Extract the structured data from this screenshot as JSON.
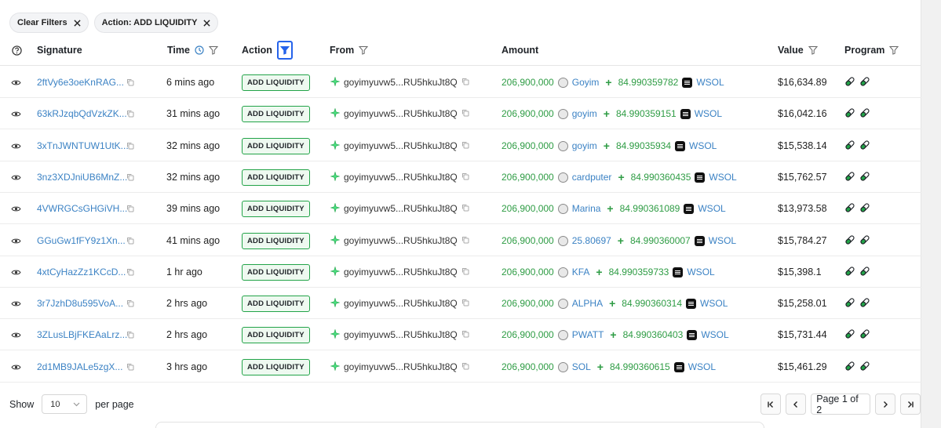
{
  "filters": [
    {
      "label": "Clear Filters"
    },
    {
      "label": "Action: ADD LIQUIDITY"
    }
  ],
  "columns": {
    "signature": "Signature",
    "time": "Time",
    "action": "Action",
    "from": "From",
    "amount": "Amount",
    "value": "Value",
    "program": "Program"
  },
  "rows": [
    {
      "signature": "2ftVy6e3oeKnRAG...",
      "time": "6 mins ago",
      "action": "ADD LIQUIDITY",
      "from": "goyimyuvw5...RU5hkuJt8Q",
      "amount": "206,900,000",
      "token": "Goyim",
      "sol_amount": "84.990359782",
      "sol_token": "WSOL",
      "value": "$16,634.89"
    },
    {
      "signature": "63kRJzqbQdVzkZK...",
      "time": "31 mins ago",
      "action": "ADD LIQUIDITY",
      "from": "goyimyuvw5...RU5hkuJt8Q",
      "amount": "206,900,000",
      "token": "goyim",
      "sol_amount": "84.990359151",
      "sol_token": "WSOL",
      "value": "$16,042.16"
    },
    {
      "signature": "3xTnJWNTUW1UtK...",
      "time": "32 mins ago",
      "action": "ADD LIQUIDITY",
      "from": "goyimyuvw5...RU5hkuJt8Q",
      "amount": "206,900,000",
      "token": "goyim",
      "sol_amount": "84.99035934",
      "sol_token": "WSOL",
      "value": "$15,538.14"
    },
    {
      "signature": "3nz3XDJniUB6MnZ...",
      "time": "32 mins ago",
      "action": "ADD LIQUIDITY",
      "from": "goyimyuvw5...RU5hkuJt8Q",
      "amount": "206,900,000",
      "token": "cardputer",
      "sol_amount": "84.990360435",
      "sol_token": "WSOL",
      "value": "$15,762.57"
    },
    {
      "signature": "4VWRGCsGHGiVH...",
      "time": "39 mins ago",
      "action": "ADD LIQUIDITY",
      "from": "goyimyuvw5...RU5hkuJt8Q",
      "amount": "206,900,000",
      "token": "Marina",
      "sol_amount": "84.990361089",
      "sol_token": "WSOL",
      "value": "$13,973.58"
    },
    {
      "signature": "GGuGw1fFY9z1Xn...",
      "time": "41 mins ago",
      "action": "ADD LIQUIDITY",
      "from": "goyimyuvw5...RU5hkuJt8Q",
      "amount": "206,900,000",
      "token": "25.80697",
      "sol_amount": "84.990360007",
      "sol_token": "WSOL",
      "value": "$15,784.27"
    },
    {
      "signature": "4xtCyHazZz1KCcD...",
      "time": "1 hr ago",
      "action": "ADD LIQUIDITY",
      "from": "goyimyuvw5...RU5hkuJt8Q",
      "amount": "206,900,000",
      "token": "KFA",
      "sol_amount": "84.990359733",
      "sol_token": "WSOL",
      "value": "$15,398.1"
    },
    {
      "signature": "3r7JzhD8u595VoA...",
      "time": "2 hrs ago",
      "action": "ADD LIQUIDITY",
      "from": "goyimyuvw5...RU5hkuJt8Q",
      "amount": "206,900,000",
      "token": "ALPHA",
      "sol_amount": "84.990360314",
      "sol_token": "WSOL",
      "value": "$15,258.01"
    },
    {
      "signature": "3ZLusLBjFKEAaLrz...",
      "time": "2 hrs ago",
      "action": "ADD LIQUIDITY",
      "from": "goyimyuvw5...RU5hkuJt8Q",
      "amount": "206,900,000",
      "token": "PWATT",
      "sol_amount": "84.990360403",
      "sol_token": "WSOL",
      "value": "$15,731.44"
    },
    {
      "signature": "2d1MB9JALe5zgX...",
      "time": "3 hrs ago",
      "action": "ADD LIQUIDITY",
      "from": "goyimyuvw5...RU5hkuJt8Q",
      "amount": "206,900,000",
      "token": "SOL",
      "sol_amount": "84.990360615",
      "sol_token": "WSOL",
      "value": "$15,461.29"
    }
  ],
  "footer": {
    "show_label": "Show",
    "per_page_value": "10",
    "per_page_label": "per page",
    "page_info": "Page 1 of 2"
  },
  "colors": {
    "link": "#3b82c4",
    "amount_green": "#2e9c44",
    "badge_border": "#22a348",
    "active_filter": "#2563eb"
  }
}
